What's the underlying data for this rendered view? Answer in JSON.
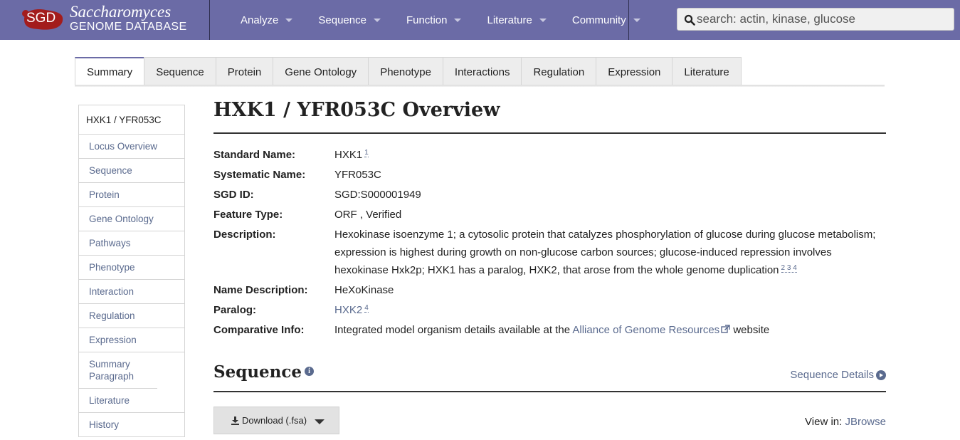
{
  "header": {
    "logo_abbrev": "SGD",
    "logo_line1": "Saccharomyces",
    "logo_line2": "GENOME DATABASE",
    "brand_color": "#6b6ba6",
    "logo_color": "#a31c1c",
    "nav": [
      "Analyze",
      "Sequence",
      "Function",
      "Literature",
      "Community"
    ],
    "search_placeholder": "search: actin, kinase, glucose",
    "search_icon": "search-icon"
  },
  "tabs": {
    "items": [
      "Summary",
      "Sequence",
      "Protein",
      "Gene Ontology",
      "Phenotype",
      "Interactions",
      "Regulation",
      "Expression",
      "Literature"
    ],
    "active": "Summary"
  },
  "sidebar": {
    "heading": "HXK1 / YFR053C",
    "items": [
      "Locus Overview",
      "Sequence",
      "Protein",
      "Gene Ontology",
      "Pathways",
      "Phenotype",
      "Interaction",
      "Regulation",
      "Expression",
      "Summary Paragraph",
      "Literature",
      "History"
    ]
  },
  "overview": {
    "title": "HXK1 / YFR053C Overview",
    "standard_name_label": "Standard Name:",
    "standard_name": "HXK1",
    "standard_name_ref": "1",
    "systematic_name_label": "Systematic Name:",
    "systematic_name": "YFR053C",
    "sgd_id_label": "SGD ID:",
    "sgd_id": "SGD:S000001949",
    "feature_type_label": "Feature Type:",
    "feature_type": "ORF , Verified",
    "description_label": "Description:",
    "description": "Hexokinase isoenzyme 1; a cytosolic protein that catalyzes phosphorylation of glucose during glucose metabolism; expression is highest during growth on non-glucose carbon sources; glucose-induced repression involves hexokinase Hxk2p; HXK1 has a paralog, HXK2, that arose from the whole genome duplication",
    "description_refs": "2 3 4",
    "name_description_label": "Name Description:",
    "name_description": "HeXoKinase",
    "paralog_label": "Paralog:",
    "paralog": "HXK2",
    "paralog_ref": "4",
    "comparative_label": "Comparative Info:",
    "comparative_prefix": "Integrated model organism details available at the",
    "comparative_link": "Alliance of Genome Resources",
    "comparative_suffix": "website"
  },
  "sequence": {
    "title": "Sequence",
    "details_link": "Sequence Details",
    "download_label": "Download (.fsa)",
    "view_in_label": "View in:",
    "view_in_link": "JBrowse"
  }
}
